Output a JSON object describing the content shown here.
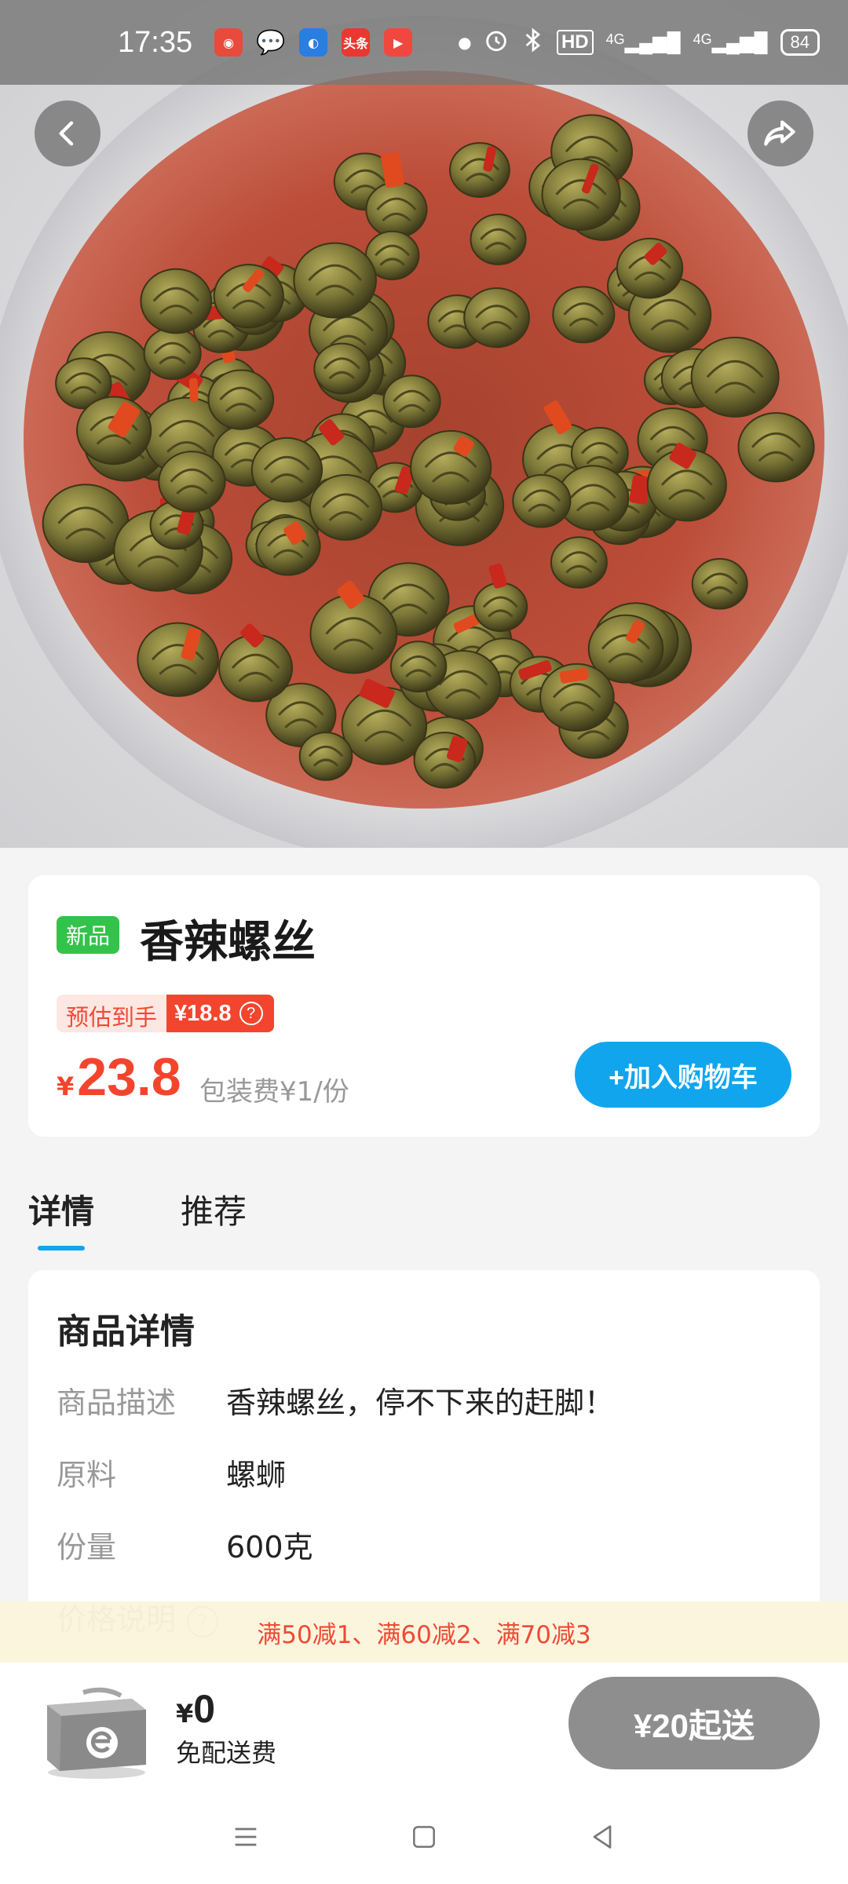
{
  "status_bar": {
    "time": "17:35",
    "apps": [
      {
        "icon": "location-app-icon",
        "color": "#e84a3c",
        "text": ""
      },
      {
        "icon": "wechat-icon",
        "color": "transparent",
        "text": ""
      },
      {
        "icon": "news-app-icon",
        "color": "#2a7de1",
        "text": ""
      },
      {
        "icon": "toutiao-app-icon",
        "color": "#e8382f",
        "text": "头条"
      },
      {
        "icon": "video-app-icon",
        "color": "#f0483e",
        "text": ""
      }
    ],
    "indicators": [
      "HD",
      "4G",
      "4G"
    ],
    "battery": "84"
  },
  "header": {
    "back_icon": "chevron-left-icon",
    "share_icon": "share-icon"
  },
  "product": {
    "badge": "新品",
    "name": "香辣螺丝",
    "estimate_label": "预估到手",
    "estimate_price": "¥18.8",
    "estimate_help": "?",
    "currency": "¥",
    "price": "23.8",
    "packaging_fee": "包装费¥1/份",
    "add_to_cart": "+加入购物车"
  },
  "tabs": [
    {
      "label": "详情",
      "active": true
    },
    {
      "label": "推荐",
      "active": false
    }
  ],
  "details": {
    "title": "商品详情",
    "rows": [
      {
        "key": "商品描述",
        "value": "香辣螺丝，停不下来的赶脚！"
      },
      {
        "key": "原料",
        "value": "螺蛳"
      },
      {
        "key": "份量",
        "value": "600克"
      },
      {
        "key": "价格说明",
        "value": ""
      }
    ]
  },
  "promo": "满50减1、满60减2、满70减3",
  "bottom": {
    "currency": "¥",
    "delivery_fee": "0",
    "delivery_note": "免配送费",
    "min_order": "¥20起送"
  },
  "colors": {
    "accent_blue": "#11a5ee",
    "price_red": "#f3452d",
    "new_green": "#33c34a"
  }
}
